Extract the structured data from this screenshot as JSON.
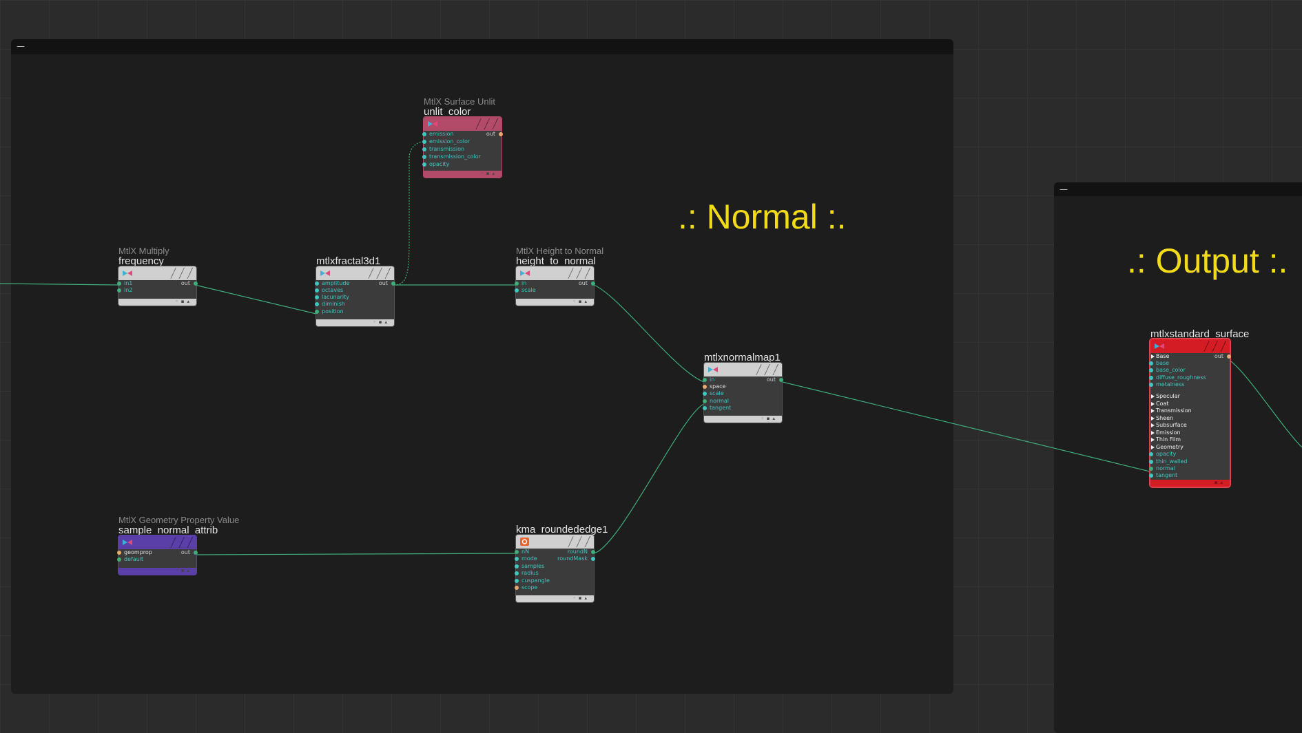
{
  "netboxes": {
    "main_collapse": "—",
    "output_collapse": "—"
  },
  "stickies": {
    "normal": ".: Normal :.",
    "output": ".: Output :."
  },
  "colors": {
    "background": "#2b2b2b",
    "netbox": "#1d1d1d",
    "sticky_text": "#f2dc1a",
    "wire": "#3fae7a",
    "input_port": "#3fc7c2",
    "unlit_header": "#b24a6a",
    "geom_header": "#5a3fa8",
    "standard_surface_header": "#d41c24",
    "default_header": "#d0d0d0"
  },
  "nodes": {
    "frequency": {
      "type": "MtlX Multiply",
      "name": "frequency",
      "inputs": [
        "in1",
        "in2"
      ],
      "output": "out"
    },
    "fractal": {
      "type": "",
      "name": "mtlxfractal3d1",
      "inputs": [
        "amplitude",
        "octaves",
        "lacunarity",
        "diminish",
        "position"
      ],
      "output": "out"
    },
    "unlit": {
      "type": "MtlX Surface Unlit",
      "name": "unlit_color",
      "inputs": [
        "emission",
        "emission_color",
        "transmission",
        "transmission_color",
        "opacity"
      ],
      "output": "out"
    },
    "height_to_normal": {
      "type": "MtlX Height to Normal",
      "name": "height_to_normal",
      "inputs": [
        "in",
        "scale"
      ],
      "output": "out"
    },
    "normalmap": {
      "type": "",
      "name": "mtlxnormalmap1",
      "inputs": [
        "in",
        "space",
        "scale",
        "normal",
        "tangent"
      ],
      "output": "out"
    },
    "geom": {
      "type": "MtlX Geometry Property Value",
      "name": "sample_normal_attrib",
      "inputs": [
        "geomprop",
        "default"
      ],
      "output": "out"
    },
    "roundededge": {
      "type": "",
      "name": "kma_roundededge1",
      "inputs": [
        "nN",
        "mode",
        "samples",
        "radius",
        "cuspangle",
        "scope"
      ],
      "outputs": [
        "roundN",
        "roundMask"
      ]
    },
    "standard_surface": {
      "type": "",
      "name": "mtlxstandard_surface",
      "output": "out",
      "rows": [
        {
          "kind": "section",
          "label": "Base"
        },
        {
          "kind": "input",
          "label": "base"
        },
        {
          "kind": "input",
          "label": "base_color"
        },
        {
          "kind": "input",
          "label": "diffuse_roughness"
        },
        {
          "kind": "input",
          "label": "metalness"
        },
        {
          "kind": "section",
          "label": "Specular"
        },
        {
          "kind": "section",
          "label": "Coat"
        },
        {
          "kind": "section",
          "label": "Transmission"
        },
        {
          "kind": "section",
          "label": "Sheen"
        },
        {
          "kind": "section",
          "label": "Subsurface"
        },
        {
          "kind": "section",
          "label": "Emission"
        },
        {
          "kind": "section",
          "label": "Thin Film"
        },
        {
          "kind": "section",
          "label": "Geometry"
        },
        {
          "kind": "input",
          "label": "opacity"
        },
        {
          "kind": "input",
          "label": "thin_walled"
        },
        {
          "kind": "input",
          "label": "normal"
        },
        {
          "kind": "input",
          "label": "tangent"
        }
      ]
    }
  }
}
